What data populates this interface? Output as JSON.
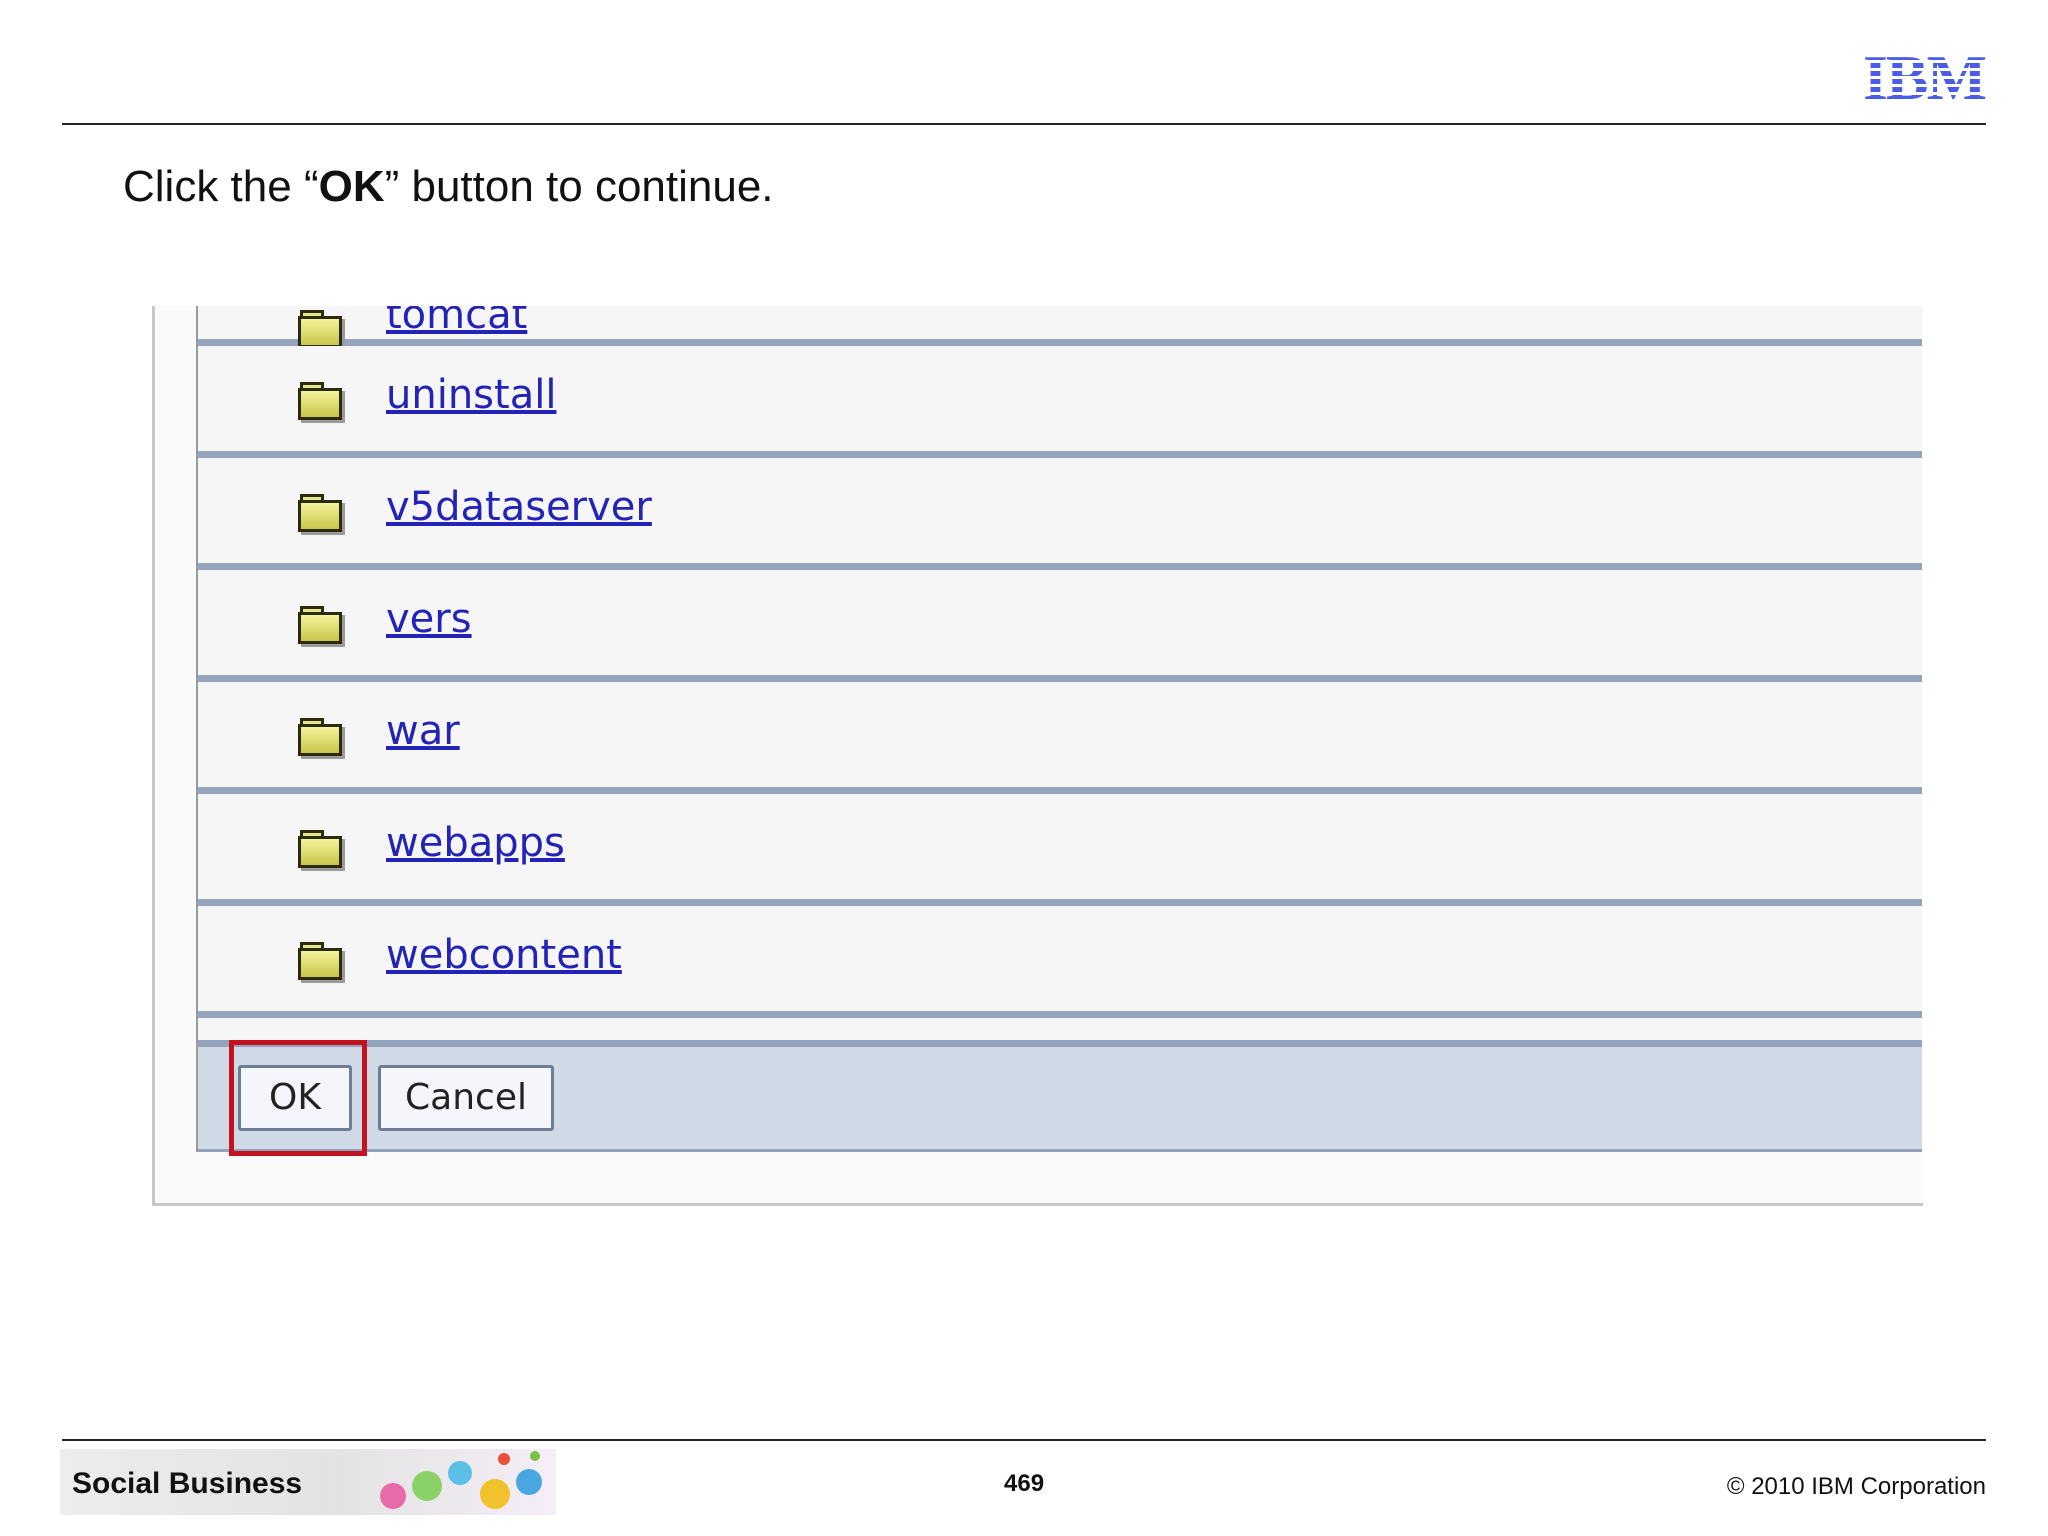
{
  "header": {
    "logo_text": "IBM"
  },
  "instruction": {
    "prefix": "Click the “",
    "bold": "OK",
    "suffix": "” button to continue."
  },
  "file_list": {
    "items": [
      {
        "name": "tomcat"
      },
      {
        "name": "uninstall"
      },
      {
        "name": "v5dataserver"
      },
      {
        "name": "vers"
      },
      {
        "name": "war"
      },
      {
        "name": "webapps"
      },
      {
        "name": "webcontent"
      }
    ]
  },
  "buttons": {
    "ok_label": "OK",
    "cancel_label": "Cancel"
  },
  "footer": {
    "brand": "Social Business",
    "page_number": "469",
    "copyright": "© 2010 IBM Corporation"
  },
  "colors": {
    "link": "#2323b8",
    "highlight": "#c4121e",
    "row_divider": "#93a4bc",
    "button_bar": "#d0dae6",
    "logo": "#4b5ce6"
  }
}
